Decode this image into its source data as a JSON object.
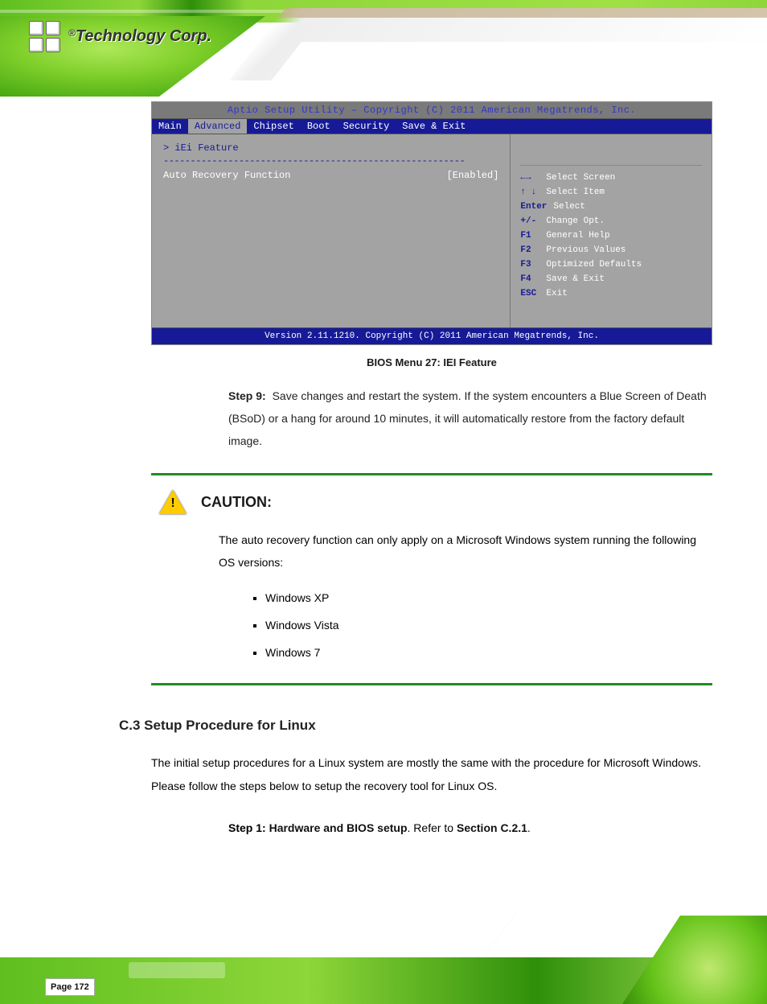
{
  "logo": {
    "text": "Technology Corp.",
    "reg": "®"
  },
  "bios": {
    "title": "Aptio Setup Utility – Copyright (C) 2011 American Megatrends, Inc.",
    "tabs": [
      "Main",
      "Advanced",
      "Chipset",
      "Boot",
      "Security",
      "Save & Exit"
    ],
    "left": {
      "header": "> iEi Feature",
      "underline": "--------------------------------------------------------",
      "row_label": "Auto Recovery Function",
      "row_value": "[Enabled]"
    },
    "right": {
      "nav": [
        {
          "key": "←→",
          "desc": "Select Screen"
        },
        {
          "key": "↑ ↓",
          "desc": "Select Item"
        },
        {
          "key": "Enter",
          "desc": "Select"
        },
        {
          "key": "+/-",
          "desc": "Change Opt."
        },
        {
          "key": "F1",
          "desc": "General Help"
        },
        {
          "key": "F2",
          "desc": "Previous Values"
        },
        {
          "key": "F3",
          "desc": "Optimized Defaults"
        },
        {
          "key": "F4",
          "desc": "Save & Exit"
        },
        {
          "key": "ESC",
          "desc": "Exit"
        }
      ]
    },
    "footer": "Version 2.11.1210. Copyright (C) 2011 American Megatrends, Inc."
  },
  "caption": "BIOS Menu 27: IEI Feature",
  "step9": {
    "num": "Step 9:",
    "text": "Save changes and restart the system. If the system encounters a Blue Screen of Death (BSoD) or a hang for around 10 minutes, it will automatically restore from the factory default image."
  },
  "caution": {
    "label": "CAUTION:",
    "intro": "The auto recovery function can only apply on a Microsoft Windows system running the following OS versions:",
    "items": [
      "Windows XP",
      "Windows Vista",
      "Windows 7"
    ]
  },
  "section_h": "C.3  Setup Procedure for Linux",
  "body1": "The initial setup procedures for a Linux system are mostly the same with the procedure for Microsoft Windows. Please follow the steps below to setup the recovery tool for Linux OS.",
  "step1": {
    "num": "Step 1:",
    "bold1": "Hardware and BIOS setup",
    "mid": ". Refer to ",
    "bold2": "Section C.2.1",
    "end": "."
  },
  "page_number": "Page 172"
}
